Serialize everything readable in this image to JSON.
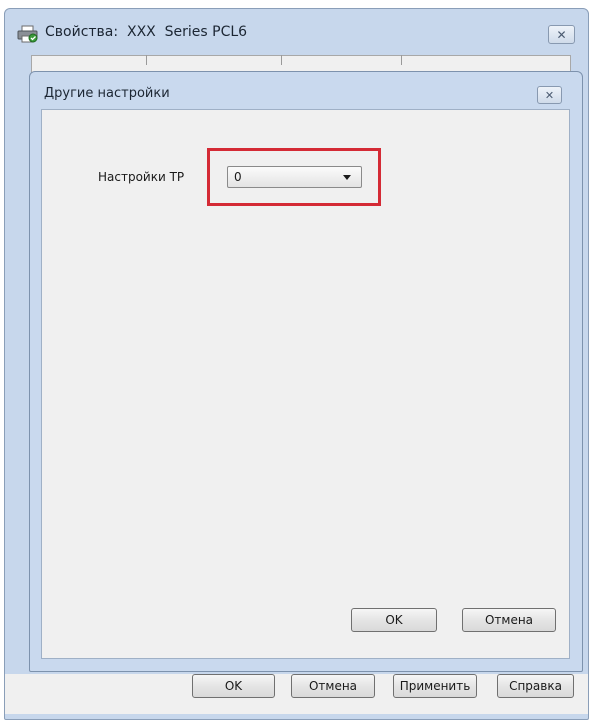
{
  "outer_window": {
    "title": "Свойства:  XXX  Series PCL6",
    "close_symbol": "✕",
    "icon": "printer-icon",
    "buttons": {
      "ok": "OK",
      "cancel": "Отмена",
      "apply": "Применить",
      "help": "Справка"
    }
  },
  "dialog": {
    "title": "Другие настройки",
    "close_symbol": "✕",
    "setting": {
      "label": "Настройки TP",
      "value": "0"
    },
    "buttons": {
      "ok": "OK",
      "cancel": "Отмена"
    }
  },
  "colors": {
    "highlight": "#d42a35",
    "window_frame": "#c7d7ec"
  }
}
